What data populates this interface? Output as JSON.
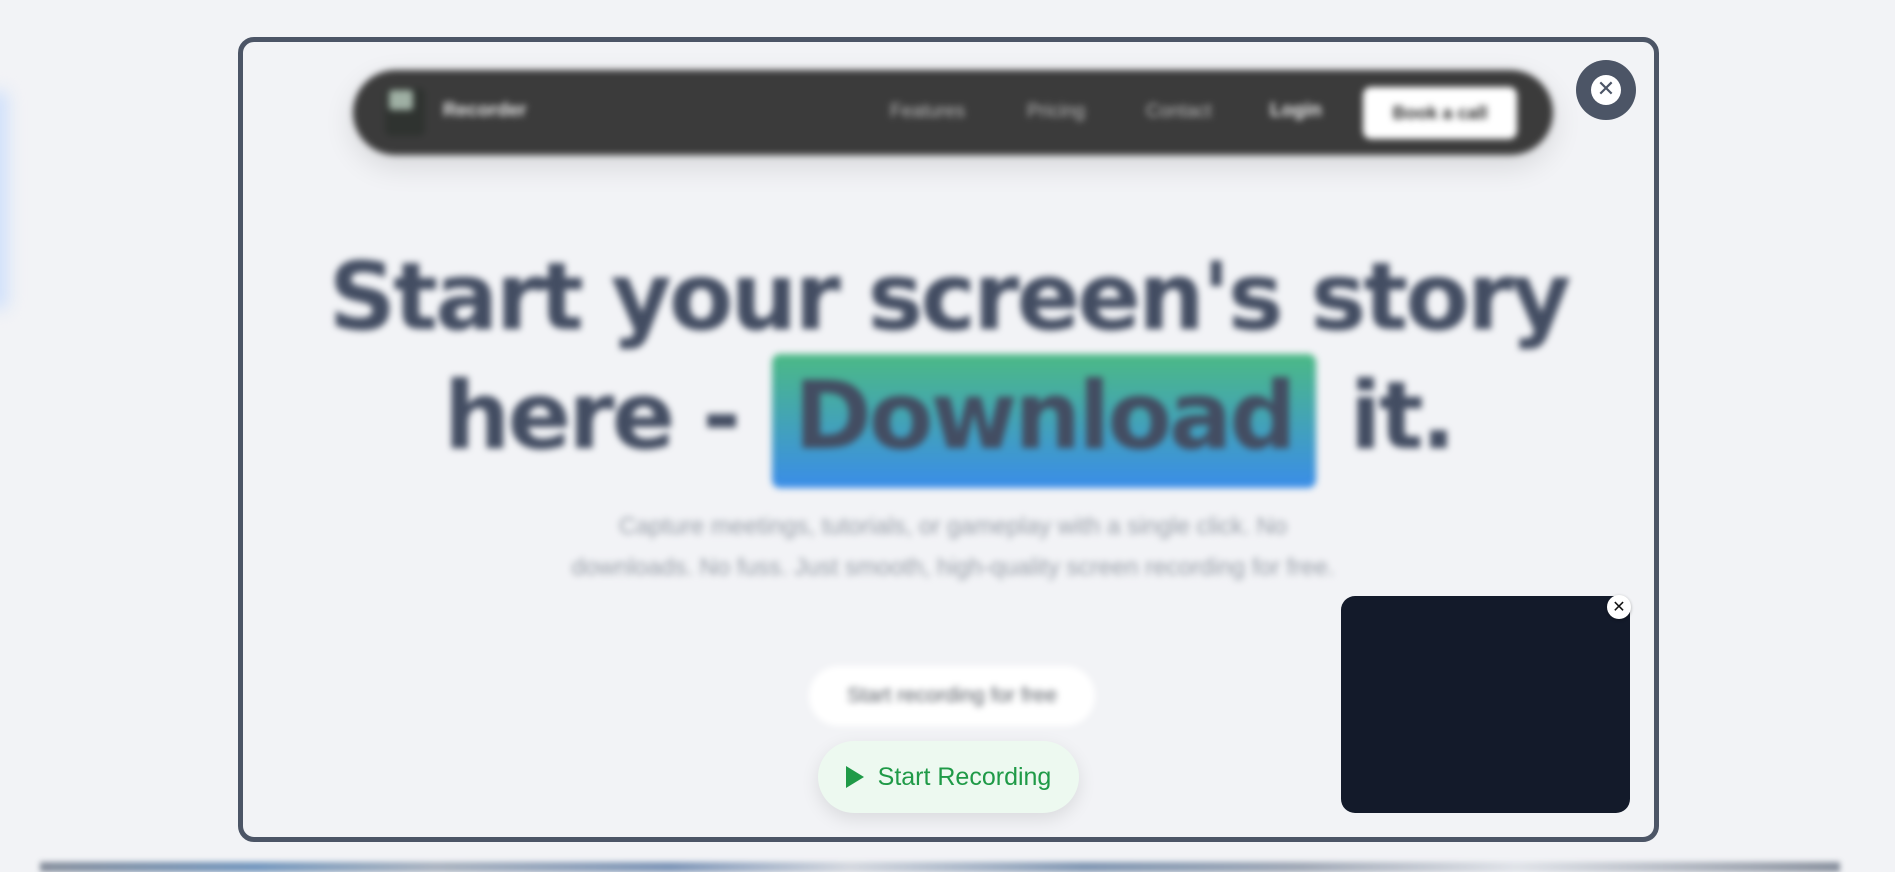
{
  "preview": {
    "navbar": {
      "brand": "Recorder",
      "links": [
        "Features",
        "Pricing",
        "Contact"
      ],
      "login": "Login",
      "cta": "Book a call"
    },
    "hero": {
      "title_line1": "Start your screen's story",
      "title_line2_prefix": "here -",
      "title_highlight": "Download",
      "title_line2_suffix": "it.",
      "subtitle_line1": "Capture meetings, tutorials, or gameplay with a single click. No",
      "subtitle_line2": "downloads. No fuss. Just smooth, high-quality screen recording for free.",
      "secondary_cta": "Start recording for free"
    },
    "highlight_colors": [
      "#4bb985",
      "#3a8de8"
    ]
  },
  "controls": {
    "start_recording_label": "Start Recording",
    "accent_color": "#1f9a47",
    "close_icon": "close-icon",
    "play_icon": "play-icon"
  }
}
